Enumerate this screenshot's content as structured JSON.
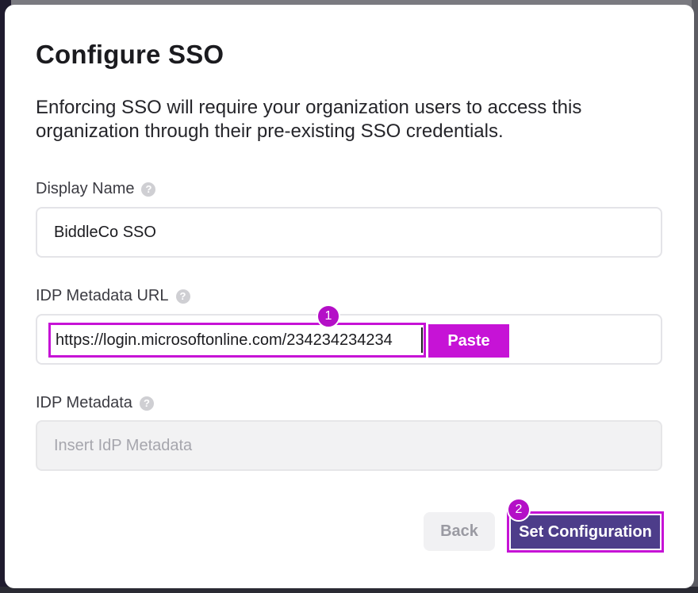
{
  "dialog": {
    "title": "Configure SSO",
    "description": "Enforcing SSO will require your organization users to access this organization through their pre-existing SSO credentials."
  },
  "fields": {
    "display_name": {
      "label": "Display Name",
      "value": "BiddleCo SSO"
    },
    "idp_metadata_url": {
      "label": "IDP Metadata URL",
      "value": "https://login.microsoftonline.com/234234234234",
      "paste_label": "Paste"
    },
    "idp_metadata": {
      "label": "IDP Metadata",
      "placeholder": "Insert IdP Metadata"
    }
  },
  "help_glyph": "?",
  "buttons": {
    "back_label": "Back",
    "set_configuration_label": "Set Configuration"
  },
  "annotations": {
    "step_1": "1",
    "step_2": "2"
  },
  "colors": {
    "highlight": "#c613d6",
    "primary_button": "#4d3d8a",
    "badge": "#b40fc7"
  },
  "icons": {
    "help": "question-circle-icon"
  }
}
